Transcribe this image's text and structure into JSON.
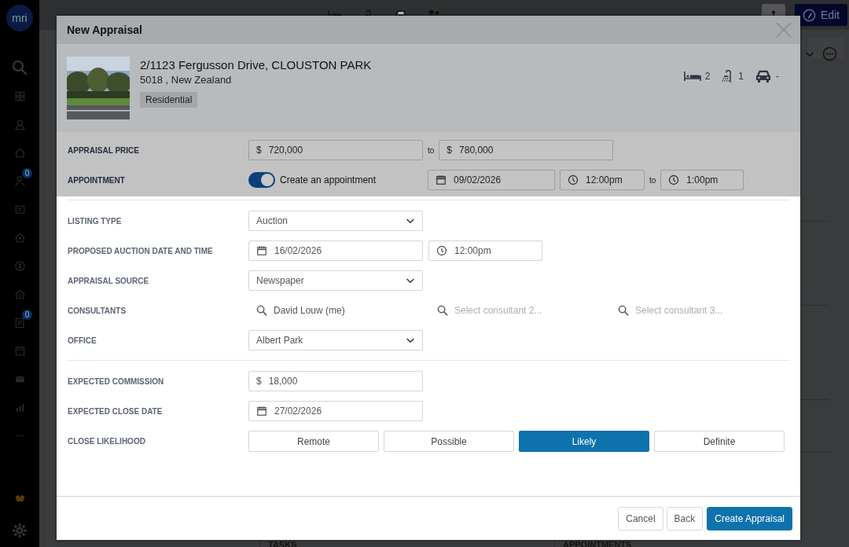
{
  "sidebar": {
    "logo": "mri",
    "items": [
      {
        "kind": "search"
      },
      {
        "kind": "grid"
      },
      {
        "kind": "person"
      },
      {
        "kind": "home"
      },
      {
        "kind": "person-key",
        "badge": "0"
      },
      {
        "kind": "document"
      },
      {
        "kind": "house-person"
      },
      {
        "kind": "dollar"
      },
      {
        "kind": "house-gear"
      },
      {
        "kind": "list",
        "badge": "0"
      },
      {
        "kind": "calendar"
      },
      {
        "kind": "mail"
      },
      {
        "kind": "chart"
      },
      {
        "kind": "dots"
      },
      {
        "kind": "logo"
      },
      {
        "kind": "gear"
      }
    ]
  },
  "page": {
    "stats": [
      {
        "kind": "bed"
      },
      {
        "kind": "shower"
      },
      {
        "kind": "car"
      },
      {
        "kind": "people"
      }
    ],
    "buttons": [
      {
        "kind": "owners"
      },
      {
        "kind": "edit",
        "label": "Edit"
      }
    ],
    "sections": [
      "TASKS",
      "APPOINTMENTS"
    ]
  },
  "modal": {
    "title": "New Appraisal",
    "property": {
      "address": "2/1123 Fergusson Drive, CLOUSTON PARK",
      "locality": "5018 , New Zealand",
      "tag": "Residential",
      "features": [
        {
          "kind": "bed",
          "value": "2"
        },
        {
          "kind": "shower",
          "value": "1"
        },
        {
          "kind": "car",
          "value": "-"
        }
      ]
    },
    "appraisal_price": {
      "label": "APPRAISAL PRICE",
      "from": {
        "currency": "$",
        "value": "720,000"
      },
      "separator": "to",
      "to": {
        "currency": "$",
        "value": "780,000"
      }
    },
    "appointment": {
      "label": "APPOINTMENT",
      "toggle": {
        "on": true,
        "label": "Create an appointment"
      },
      "date": "09/02/2026",
      "start": "12:00pm",
      "separator": "to",
      "end": "1:00pm"
    },
    "sections": [
      [
        {
          "kind": "select",
          "label": "LISTING TYPE",
          "value": "Auction"
        },
        {
          "kind": "datetime",
          "label": "PROPOSED AUCTION DATE AND TIME",
          "date": "16/02/2026",
          "time": "12:00pm"
        },
        {
          "kind": "select",
          "label": "APPRAISAL SOURCE",
          "value": "Newspaper"
        },
        {
          "kind": "consultants",
          "label": "CONSULTANTS",
          "items": [
            {
              "value": "David Louw (me)"
            },
            {
              "placeholder": "Select consultant 2..."
            },
            {
              "placeholder": "Select consultant 3..."
            }
          ]
        },
        {
          "kind": "select",
          "label": "OFFICE",
          "value": "Albert Park"
        }
      ],
      [
        {
          "kind": "currency",
          "label": "EXPECTED COMMISSION",
          "currency": "$",
          "value": "18,000"
        },
        {
          "kind": "date",
          "label": "EXPECTED CLOSE DATE",
          "value": "27/02/2026"
        },
        {
          "kind": "segmented",
          "label": "CLOSE LIKELIHOOD",
          "options": [
            {
              "label": "Remote",
              "selected": false
            },
            {
              "label": "Possible",
              "selected": false
            },
            {
              "label": "Likely",
              "selected": true
            },
            {
              "label": "Definite",
              "selected": false
            }
          ]
        }
      ]
    ],
    "buttons": [
      {
        "kind": "secondary",
        "label": "Cancel"
      },
      {
        "kind": "secondary",
        "label": "Back"
      },
      {
        "kind": "primary",
        "label": "Create Appraisal"
      }
    ]
  }
}
